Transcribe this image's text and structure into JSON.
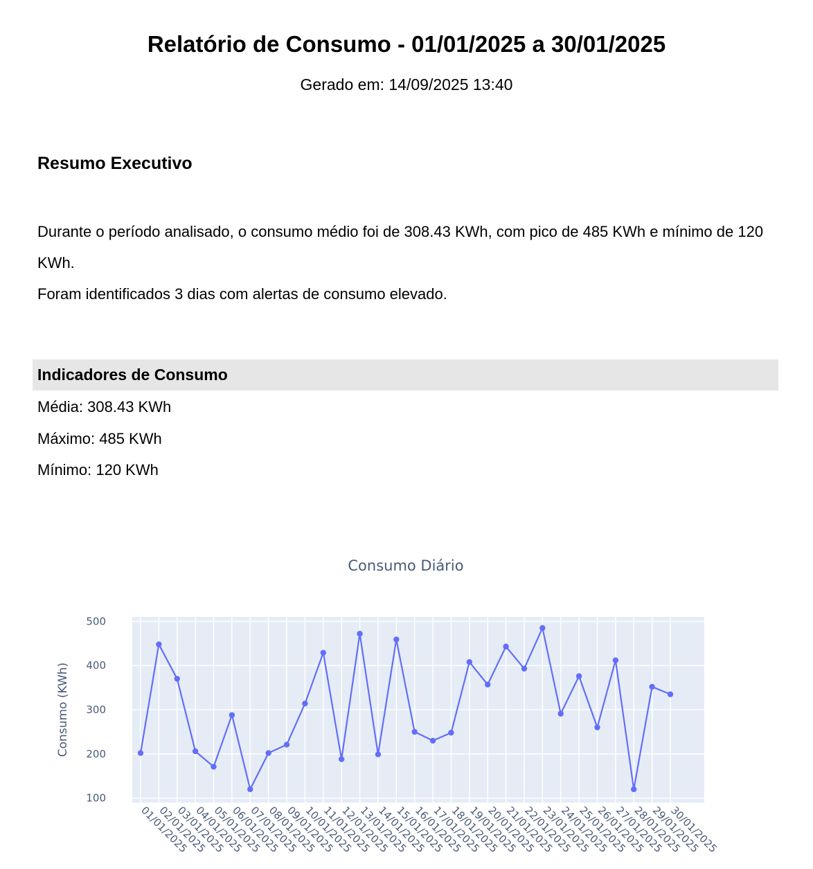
{
  "report": {
    "title": "Relatório de Consumo - 01/01/2025 a 30/01/2025",
    "generated": "Gerado em: 14/09/2025 13:40"
  },
  "summary": {
    "heading": "Resumo Executivo",
    "paragraph1": "Durante o período analisado, o consumo médio foi de 308.43 KWh, com pico de 485 KWh e mínimo de 120 KWh.",
    "paragraph2": "Foram identificados 3 dias com alertas de consumo elevado."
  },
  "indicators": {
    "heading": "Indicadores de Consumo",
    "mean": "Média: 308.43 KWh",
    "max": "Máximo: 485 KWh",
    "min": "Mínimo: 120 KWh"
  },
  "colors": {
    "line": "#636efa",
    "plot_bg": "#e5ecf6",
    "grid": "#ffffff",
    "text": "#2a3f5f"
  },
  "chart_data": {
    "type": "line",
    "title": "Consumo Diário",
    "xlabel": "",
    "ylabel": "Consumo (KWh)",
    "ylim": [
      90,
      510
    ],
    "yticks": [
      100,
      200,
      300,
      400,
      500
    ],
    "grid": true,
    "x": [
      "01/01/2025",
      "02/01/2025",
      "03/01/2025",
      "04/01/2025",
      "05/01/2025",
      "06/01/2025",
      "07/01/2025",
      "08/01/2025",
      "09/01/2025",
      "10/01/2025",
      "11/01/2025",
      "12/01/2025",
      "13/01/2025",
      "14/01/2025",
      "15/01/2025",
      "16/01/2025",
      "17/01/2025",
      "18/01/2025",
      "19/01/2025",
      "20/01/2025",
      "21/01/2025",
      "22/01/2025",
      "23/01/2025",
      "24/01/2025",
      "25/01/2025",
      "26/01/2025",
      "27/01/2025",
      "28/01/2025",
      "29/01/2025",
      "30/01/2025"
    ],
    "series": [
      {
        "values": [
          202,
          448,
          370,
          206,
          171,
          288,
          120,
          202,
          221,
          314,
          429,
          188,
          472,
          199,
          459,
          250,
          230,
          248,
          408,
          357,
          443,
          393,
          485,
          291,
          376,
          260,
          412,
          120,
          352,
          335
        ]
      }
    ]
  }
}
